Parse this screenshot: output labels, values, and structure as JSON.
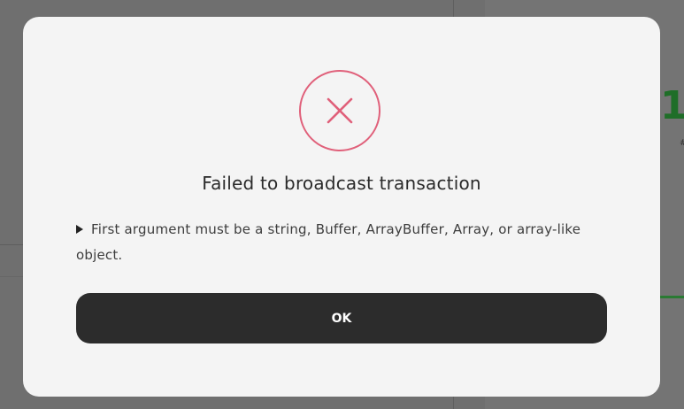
{
  "background": {
    "stat_value": "1",
    "stat_caption": "#"
  },
  "dialog": {
    "icon": "close-icon",
    "accent_color": "#e0607a",
    "title": "Failed to broadcast transaction",
    "message_icon": "disclosure-triangle-icon",
    "message": "First argument must be a string, Buffer, ArrayBuffer, Array, or array-like object.",
    "ok_label": "OK"
  }
}
